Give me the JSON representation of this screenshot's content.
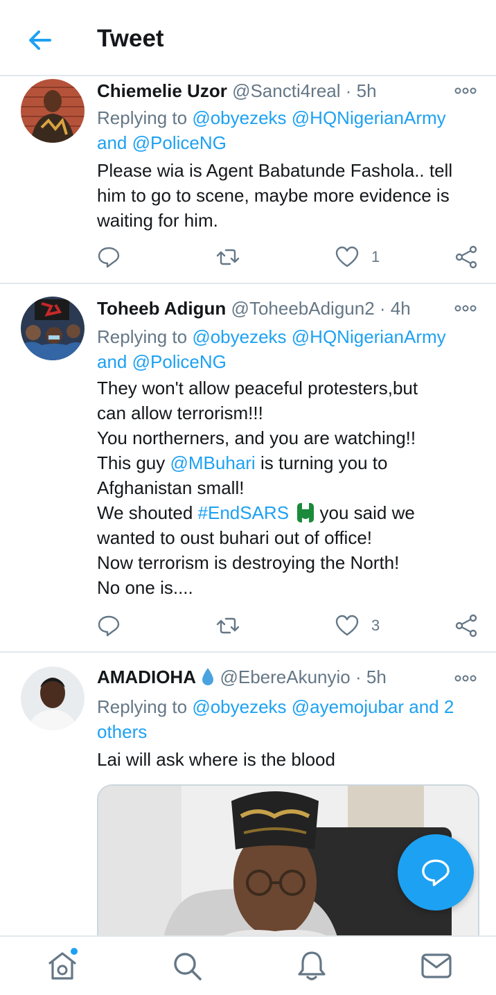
{
  "header": {
    "title": "Tweet"
  },
  "tweets": [
    {
      "name": "Chiemelie Uzor",
      "handle": "@Sancti4real",
      "time": "5h",
      "replying_label": "Replying to",
      "mention1": "@obyezeks",
      "mention2": "@HQNigerianArmy",
      "and_label": "and",
      "mention3": "@PoliceNG",
      "lines": [
        "Please wia is Agent Babatunde Fashola.. tell",
        "him to go to scene, maybe more evidence is",
        "waiting for him."
      ],
      "likes": "1"
    },
    {
      "name": "Toheeb Adigun",
      "handle": "@ToheebAdigun2",
      "time": "4h",
      "replying_label": "Replying to",
      "mention1": "@obyezeks",
      "mention2": "@HQNigerianArmy",
      "and_label": "and",
      "mention3": "@PoliceNG",
      "l1": "They won't allow peaceful protesters,but",
      "l2": "can allow terrorism!!!",
      "l3": "You northerners, and you are watching!!",
      "l4a": "This guy ",
      "l4b": "@MBuhari",
      "l4c": " is turning you to",
      "l5": "Afghanistan small!",
      "l6a": "We shouted ",
      "l6b": "#EndSARS",
      "l6c": " you said we",
      "l7": "wanted to oust buhari out of office!",
      "l8": "Now terrorism is destroying the North!",
      "l9": "No one is....",
      "likes": "3"
    },
    {
      "name": "AMADIOHA",
      "handle": "@EbereAkunyio",
      "time": "5h",
      "replying_label": "Replying to",
      "mention1": "@obyezeks",
      "mention2": "@ayemojubar",
      "and_label": "and 2",
      "others": "others",
      "body": "Lai will ask where is the blood"
    }
  ],
  "colors": {
    "accent": "#1da1f2",
    "secondary_text": "#657786",
    "divider": "#e1e8ed"
  },
  "icons": [
    "back-arrow-icon",
    "more-icon",
    "reply-icon",
    "retweet-icon",
    "like-icon",
    "share-icon",
    "compose-reply-icon",
    "home-icon",
    "search-icon",
    "notifications-icon",
    "messages-icon",
    "droplet-icon",
    "fist-icon"
  ]
}
